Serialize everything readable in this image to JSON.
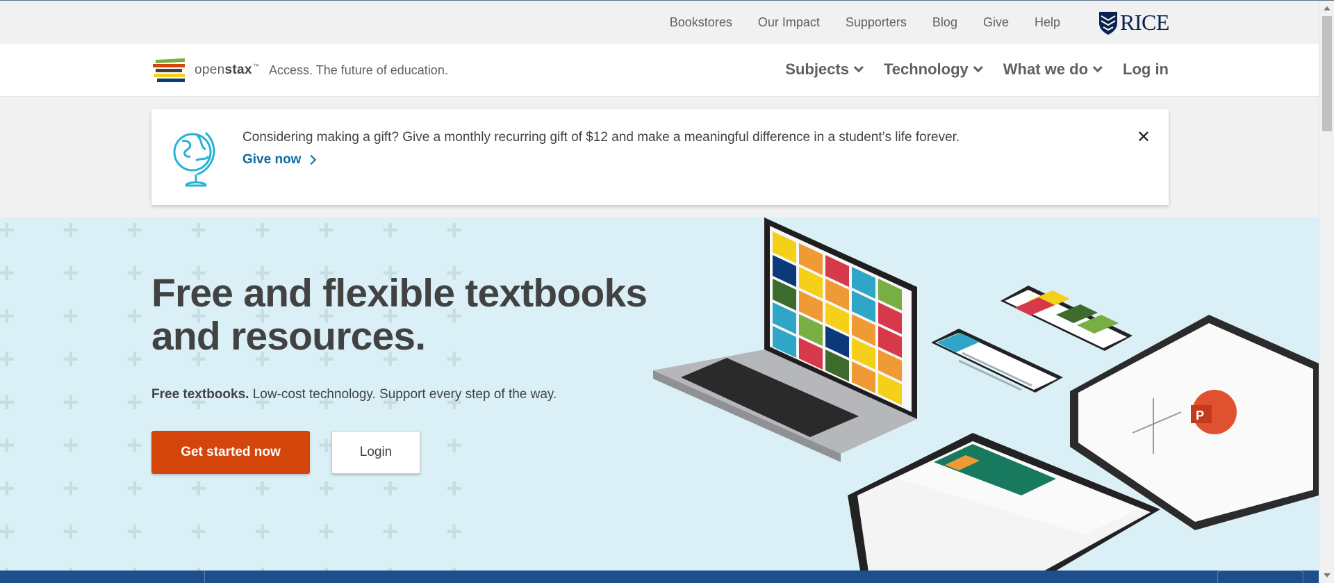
{
  "utility_nav": {
    "links": [
      "Bookstores",
      "Our Impact",
      "Supporters",
      "Blog",
      "Give",
      "Help"
    ],
    "rice_logo": "RICE"
  },
  "header": {
    "logo_prefix": "open",
    "logo_suffix": "stax",
    "logo_tm": "™",
    "tagline": "Access. The future of education.",
    "nav": [
      {
        "label": "Subjects",
        "icon": "chevron-down-icon"
      },
      {
        "label": "Technology",
        "icon": "chevron-down-icon"
      },
      {
        "label": "What we do",
        "icon": "chevron-down-icon"
      },
      {
        "label": "Log in"
      }
    ]
  },
  "banner": {
    "message": "Considering making a gift? Give a monthly recurring gift of $12 and make a meaningful difference in a student’s life forever.",
    "cta": "Give now",
    "close_icon": "✕"
  },
  "hero": {
    "title": "Free and flexible textbooks and resources.",
    "subtitle_bold": "Free textbooks.",
    "subtitle_rest": " Low-cost technology. Support every step of the way.",
    "primary_button": "Get started now",
    "secondary_button": "Login"
  },
  "colors": {
    "accent_orange": "#d4450c",
    "link_blue": "#0b6ba3",
    "hero_bg": "#daf0f6",
    "rice_navy": "#0b2350",
    "footer_blue": "#1d4f8c"
  }
}
